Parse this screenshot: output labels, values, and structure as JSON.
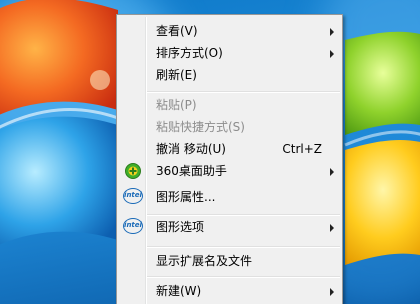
{
  "menu": {
    "items": [
      {
        "label": "查看(V)",
        "has_submenu": true
      },
      {
        "label": "排序方式(O)",
        "has_submenu": true
      },
      {
        "label": "刷新(E)"
      },
      {
        "label": "粘贴(P)",
        "disabled": true
      },
      {
        "label": "粘贴快捷方式(S)",
        "disabled": true
      },
      {
        "label": "撤消 移动(U)",
        "shortcut": "Ctrl+Z"
      },
      {
        "label": "360桌面助手",
        "icon": "360-assistant-icon",
        "has_submenu": true
      },
      {
        "label": "图形属性...",
        "icon": "intel-icon"
      },
      {
        "label": "图形选项",
        "icon": "intel-icon",
        "has_submenu": true
      },
      {
        "label": "显示扩展名及文件"
      },
      {
        "label": "新建(W)",
        "has_submenu": true
      }
    ],
    "intel_logo_text": "intel"
  },
  "colors": {
    "menu_background": "#f0f0f0",
    "disabled_text": "#8d8d8d",
    "desktop_blue": "#1a86d4"
  }
}
